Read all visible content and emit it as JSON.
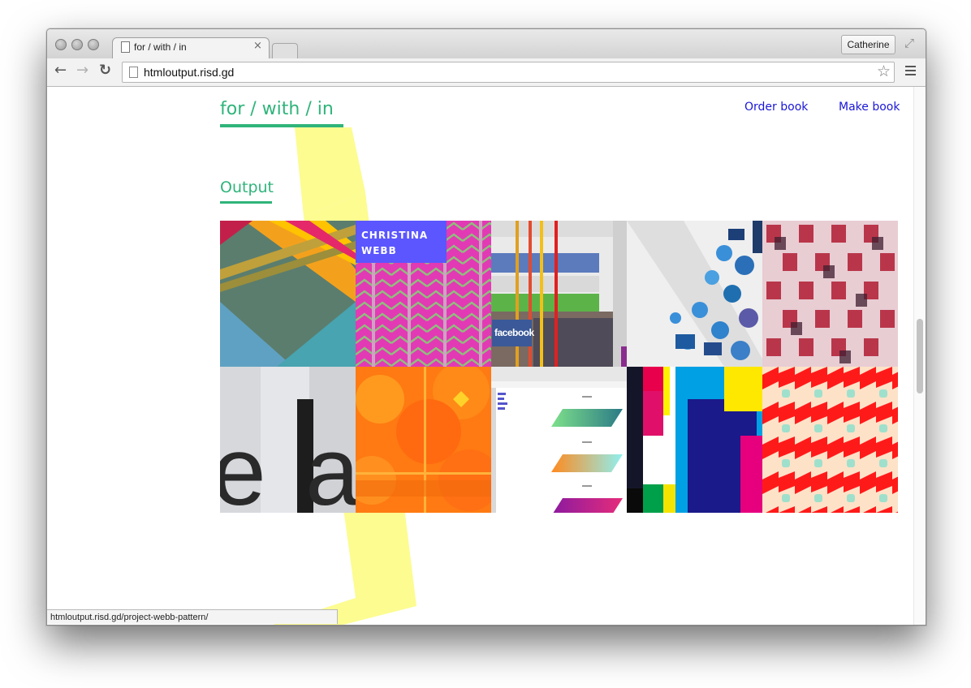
{
  "browser": {
    "tab_title": "for / with / in",
    "tab_close": "×",
    "profile_name": "Catherine",
    "url": "htmloutput.risd.gd",
    "status_url": "htmloutput.risd.gd/project-webb-pattern/",
    "icons": {
      "back": "←",
      "forward": "→",
      "reload": "↻",
      "star": "☆",
      "fullscreen": "⤢"
    }
  },
  "site": {
    "title": "for / with / in",
    "nav": [
      {
        "label": "Order book"
      },
      {
        "label": "Make book"
      }
    ],
    "section_title": "Output",
    "accent_color": "#2fb47a",
    "link_color": "#1a17d6",
    "highlight_color": "#fcfc91"
  },
  "grid": {
    "tiles": [
      {
        "id": "tile-1"
      },
      {
        "id": "tile-2",
        "label_line1": "CHRISTINA",
        "label_line2": "WEBB"
      },
      {
        "id": "tile-3",
        "label": "facebook"
      },
      {
        "id": "tile-4"
      },
      {
        "id": "tile-5"
      },
      {
        "id": "tile-6"
      },
      {
        "id": "tile-7"
      },
      {
        "id": "tile-8"
      },
      {
        "id": "tile-9"
      },
      {
        "id": "tile-10"
      }
    ]
  }
}
